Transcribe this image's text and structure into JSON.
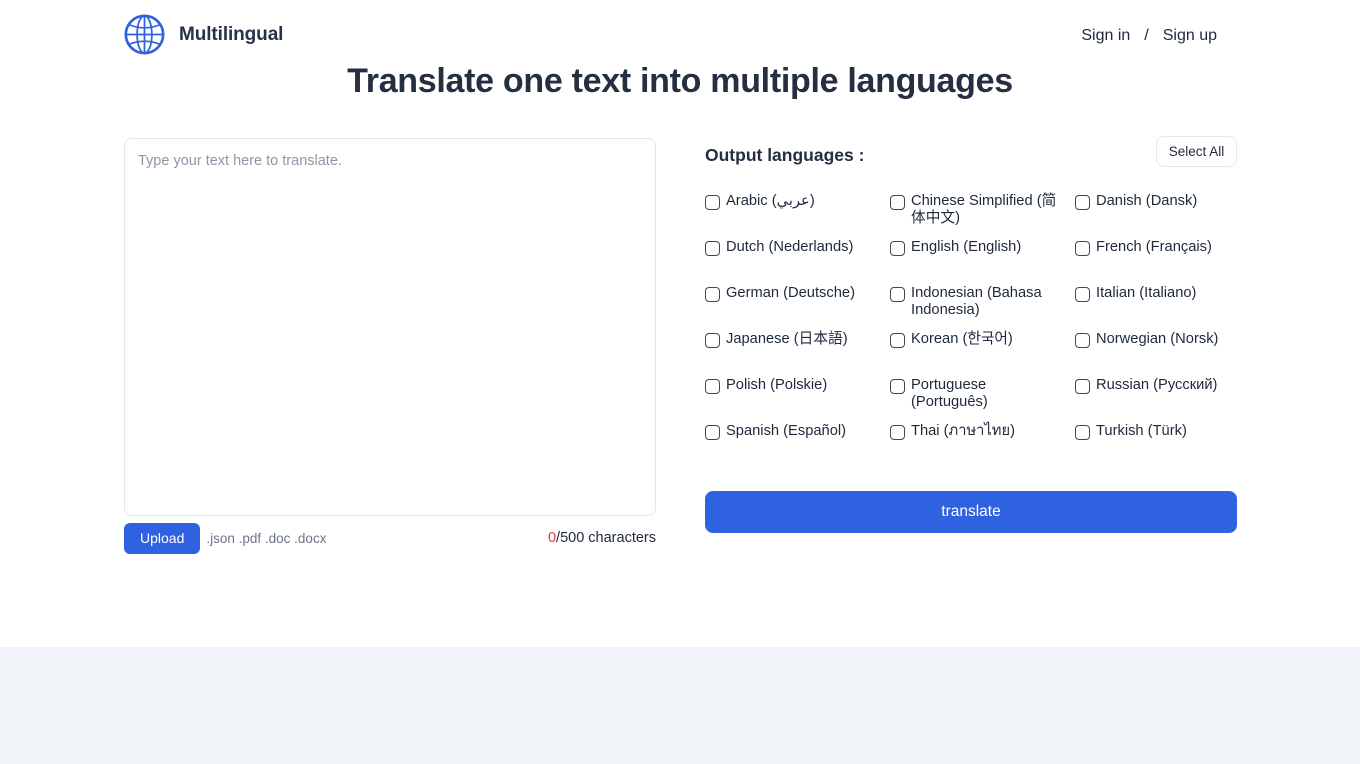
{
  "header": {
    "brand_name": "Multilingual",
    "logo_icon": "globe-icon",
    "sign_in": "Sign in",
    "separator": "/",
    "sign_up": "Sign up"
  },
  "page_title": "Translate one text into multiple languages",
  "input_panel": {
    "placeholder": "Type your text here to translate.",
    "value": "",
    "upload_label": "Upload",
    "accepted_file_types": ".json .pdf .doc .docx",
    "char_count": "0",
    "char_limit_text": "/500 characters"
  },
  "output_panel": {
    "heading": "Output languages :",
    "select_all_label": "Select All",
    "translate_label": "translate",
    "languages": [
      {
        "label": "Arabic (عربي)",
        "checked": false
      },
      {
        "label": "Chinese Simplified (简体中文)",
        "checked": false
      },
      {
        "label": "Danish (Dansk)",
        "checked": false
      },
      {
        "label": "Dutch (Nederlands)",
        "checked": false
      },
      {
        "label": "English (English)",
        "checked": false
      },
      {
        "label": "French (Français)",
        "checked": false
      },
      {
        "label": "German (Deutsche)",
        "checked": false
      },
      {
        "label": "Indonesian (Bahasa Indonesia)",
        "checked": false
      },
      {
        "label": "Italian (Italiano)",
        "checked": false
      },
      {
        "label": "Japanese (日本語)",
        "checked": false
      },
      {
        "label": "Korean (한국어)",
        "checked": false
      },
      {
        "label": "Norwegian (Norsk)",
        "checked": false
      },
      {
        "label": "Polish (Polskie)",
        "checked": false
      },
      {
        "label": "Portuguese (Português)",
        "checked": false
      },
      {
        "label": "Russian (Русский)",
        "checked": false
      },
      {
        "label": "Spanish (Español)",
        "checked": false
      },
      {
        "label": "Thai (ภาษาไทย)",
        "checked": false
      },
      {
        "label": "Turkish (Türk)",
        "checked": false
      }
    ]
  },
  "colors": {
    "primary_blue": "#2f62e0",
    "logo_blue": "#2f62e0",
    "text_dark": "#1e293b",
    "counter_red": "#e0393e",
    "footer_bg": "#f1f4f9"
  }
}
